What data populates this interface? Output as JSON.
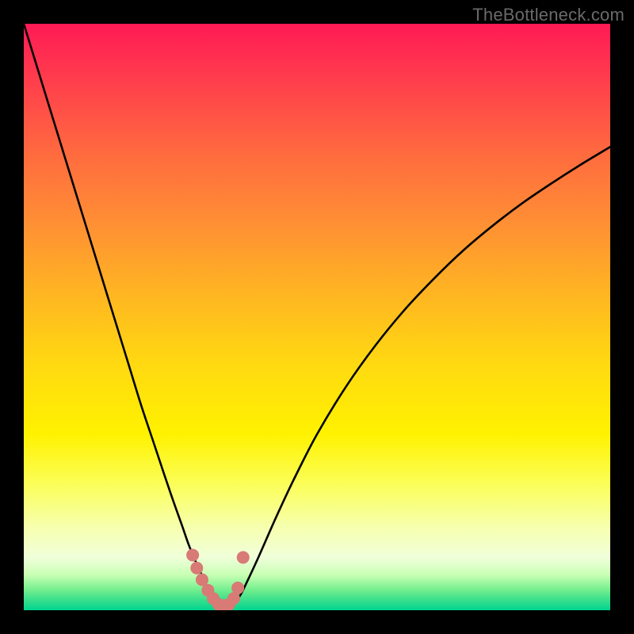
{
  "watermark": "TheBottleneck.com",
  "colors": {
    "background": "#000000",
    "curve": "#000000",
    "marker": "#d87a75",
    "gradient_top": "#ff1a55",
    "gradient_bottom": "#00d48f"
  },
  "chart_data": {
    "type": "line",
    "title": "",
    "xlabel": "",
    "ylabel": "",
    "xlim": [
      0,
      100
    ],
    "ylim": [
      0,
      100
    ],
    "x": [
      0,
      2,
      4,
      6,
      8,
      10,
      12,
      14,
      16,
      18,
      20,
      22,
      24,
      25.5,
      27,
      28,
      29,
      30,
      30.8,
      31.5,
      32,
      32.5,
      33,
      33.5,
      34,
      34.5,
      35,
      36,
      37,
      38,
      40,
      43,
      46,
      50,
      55,
      60,
      65,
      70,
      75,
      80,
      85,
      90,
      95,
      100
    ],
    "y": [
      100,
      93.5,
      87,
      80.5,
      74,
      67.5,
      61,
      54.5,
      48,
      41.5,
      35,
      29,
      23,
      18.6,
      14.4,
      11.5,
      9,
      6.8,
      5,
      3.6,
      2.6,
      1.9,
      1.3,
      0.9,
      0.7,
      0.6,
      0.7,
      1.3,
      2.7,
      4.7,
      9,
      15.8,
      22.2,
      30,
      38.2,
      45.2,
      51.3,
      56.6,
      61.4,
      65.6,
      69.4,
      72.8,
      76,
      79
    ],
    "markers_x": [
      28.8,
      29.5,
      30.4,
      31.4,
      32.3,
      33.2,
      34.1,
      35.0,
      35.8,
      36.5,
      37.4
    ],
    "markers_y": [
      9.4,
      7.2,
      5.2,
      3.4,
      2.0,
      1.0,
      0.8,
      1.0,
      2.0,
      3.8,
      9.0
    ]
  }
}
